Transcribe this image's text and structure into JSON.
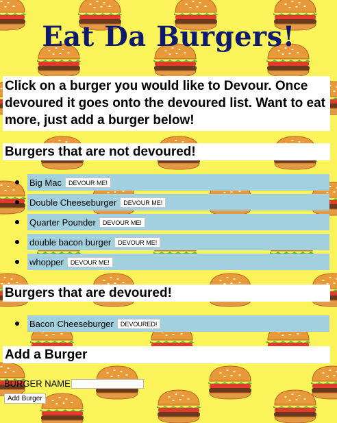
{
  "header": {
    "title": "Eat Da Burgers!"
  },
  "intro": {
    "text": "Click on a burger you would like to Devour. Once devoured it goes onto the devoured list. Want to eat more, just add a burger below!"
  },
  "not_devoured": {
    "heading": "Burgers that are not devoured!",
    "button_label": "DEVOUR ME!",
    "items": [
      {
        "name": "Big Mac"
      },
      {
        "name": "Double Cheeseburger"
      },
      {
        "name": "Quarter Pounder"
      },
      {
        "name": "double bacon burger"
      },
      {
        "name": "whopper"
      }
    ]
  },
  "devoured": {
    "heading": "Burgers that are devoured!",
    "button_label": "DEVOURED!",
    "items": [
      {
        "name": "Bacon Cheeseburger"
      }
    ]
  },
  "add_section": {
    "heading": "Add a Burger",
    "field_label": "BURGER NAME",
    "field_value": "",
    "button_label": "Add Burger"
  },
  "colors": {
    "background": "#fbf35a",
    "title": "#0d1a6e",
    "list_row": "#a2d0de"
  }
}
